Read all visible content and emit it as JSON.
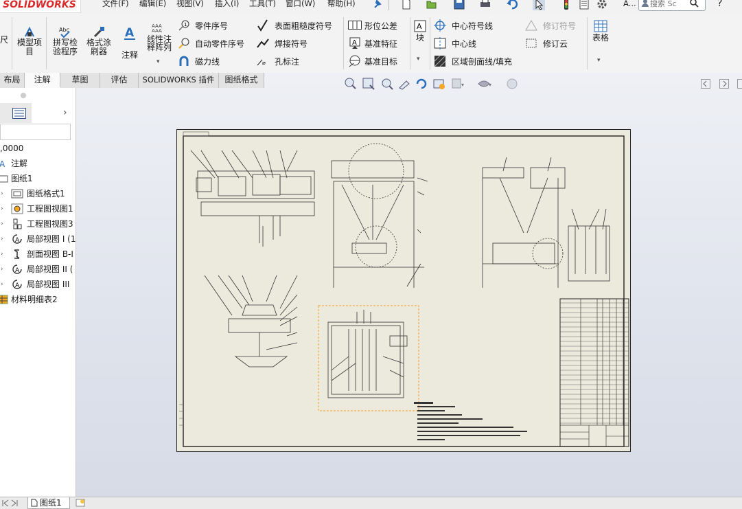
{
  "app": {
    "logo": "SOLIDWORKS",
    "logo_prefix": "S"
  },
  "menu": [
    "文件(F)",
    "编辑(E)",
    "视图(V)",
    "插入(I)",
    "工具(T)",
    "窗口(W)",
    "帮助(H)"
  ],
  "search": {
    "placeholder": "搜索 Sc"
  },
  "menu_more": "A...",
  "help": "?",
  "commands": {
    "dim_partial": "尺",
    "model_items": "模型项目",
    "spell_check": "拼写检验程序",
    "format_painter": "格式涂刷器",
    "note": "注释",
    "linear_note_pattern": "线性注释阵列",
    "balloon": "零件序号",
    "auto_balloon": "自动零件序号",
    "magnetic_line": "磁力线",
    "surface_finish": "表面粗糙度符号",
    "weld_symbol": "焊接符号",
    "hole_callout": "孔标注",
    "gtol": "形位公差",
    "datum_feature": "基准特征",
    "datum_target": "基准目标",
    "block": "块",
    "center_mark": "中心符号线",
    "centerline": "中心线",
    "area_hatch": "区域剖面线/填充",
    "revision_symbol": "修订符号",
    "revision_cloud": "修订云",
    "table": "表格"
  },
  "tabs": [
    "布局",
    "注解",
    "草图",
    "评估",
    "SOLIDWORKS 插件",
    "图纸格式"
  ],
  "active_tab": "注解",
  "tree": {
    "scale": ",0000",
    "nodes": [
      {
        "label": "注解",
        "icon": "annotation-icon",
        "indent": 0
      },
      {
        "label": "图纸1",
        "icon": "sheet-icon",
        "indent": 0
      },
      {
        "label": "图纸格式1",
        "icon": "sheet-format-icon",
        "indent": 1
      },
      {
        "label": "工程图视图1",
        "icon": "drawing-view-icon",
        "indent": 1
      },
      {
        "label": "工程图视图3",
        "icon": "drawing-view-icon",
        "indent": 1
      },
      {
        "label": "局部视图 I (1",
        "icon": "detail-view-icon",
        "indent": 1
      },
      {
        "label": "剖面视图 B-I",
        "icon": "section-view-icon",
        "indent": 1
      },
      {
        "label": "局部视图 II (",
        "icon": "detail-view-icon",
        "indent": 1
      },
      {
        "label": "局部视图 III",
        "icon": "detail-view-icon",
        "indent": 1
      },
      {
        "label": "材料明细表2",
        "icon": "bom-icon",
        "indent": 0
      }
    ]
  },
  "bottom": {
    "sheet_tab": "图纸1"
  },
  "colors": {
    "accent": "#d92b2b",
    "sheet": "#ebeadd",
    "selection": "#f0a030",
    "background": "#e3e6ee"
  }
}
